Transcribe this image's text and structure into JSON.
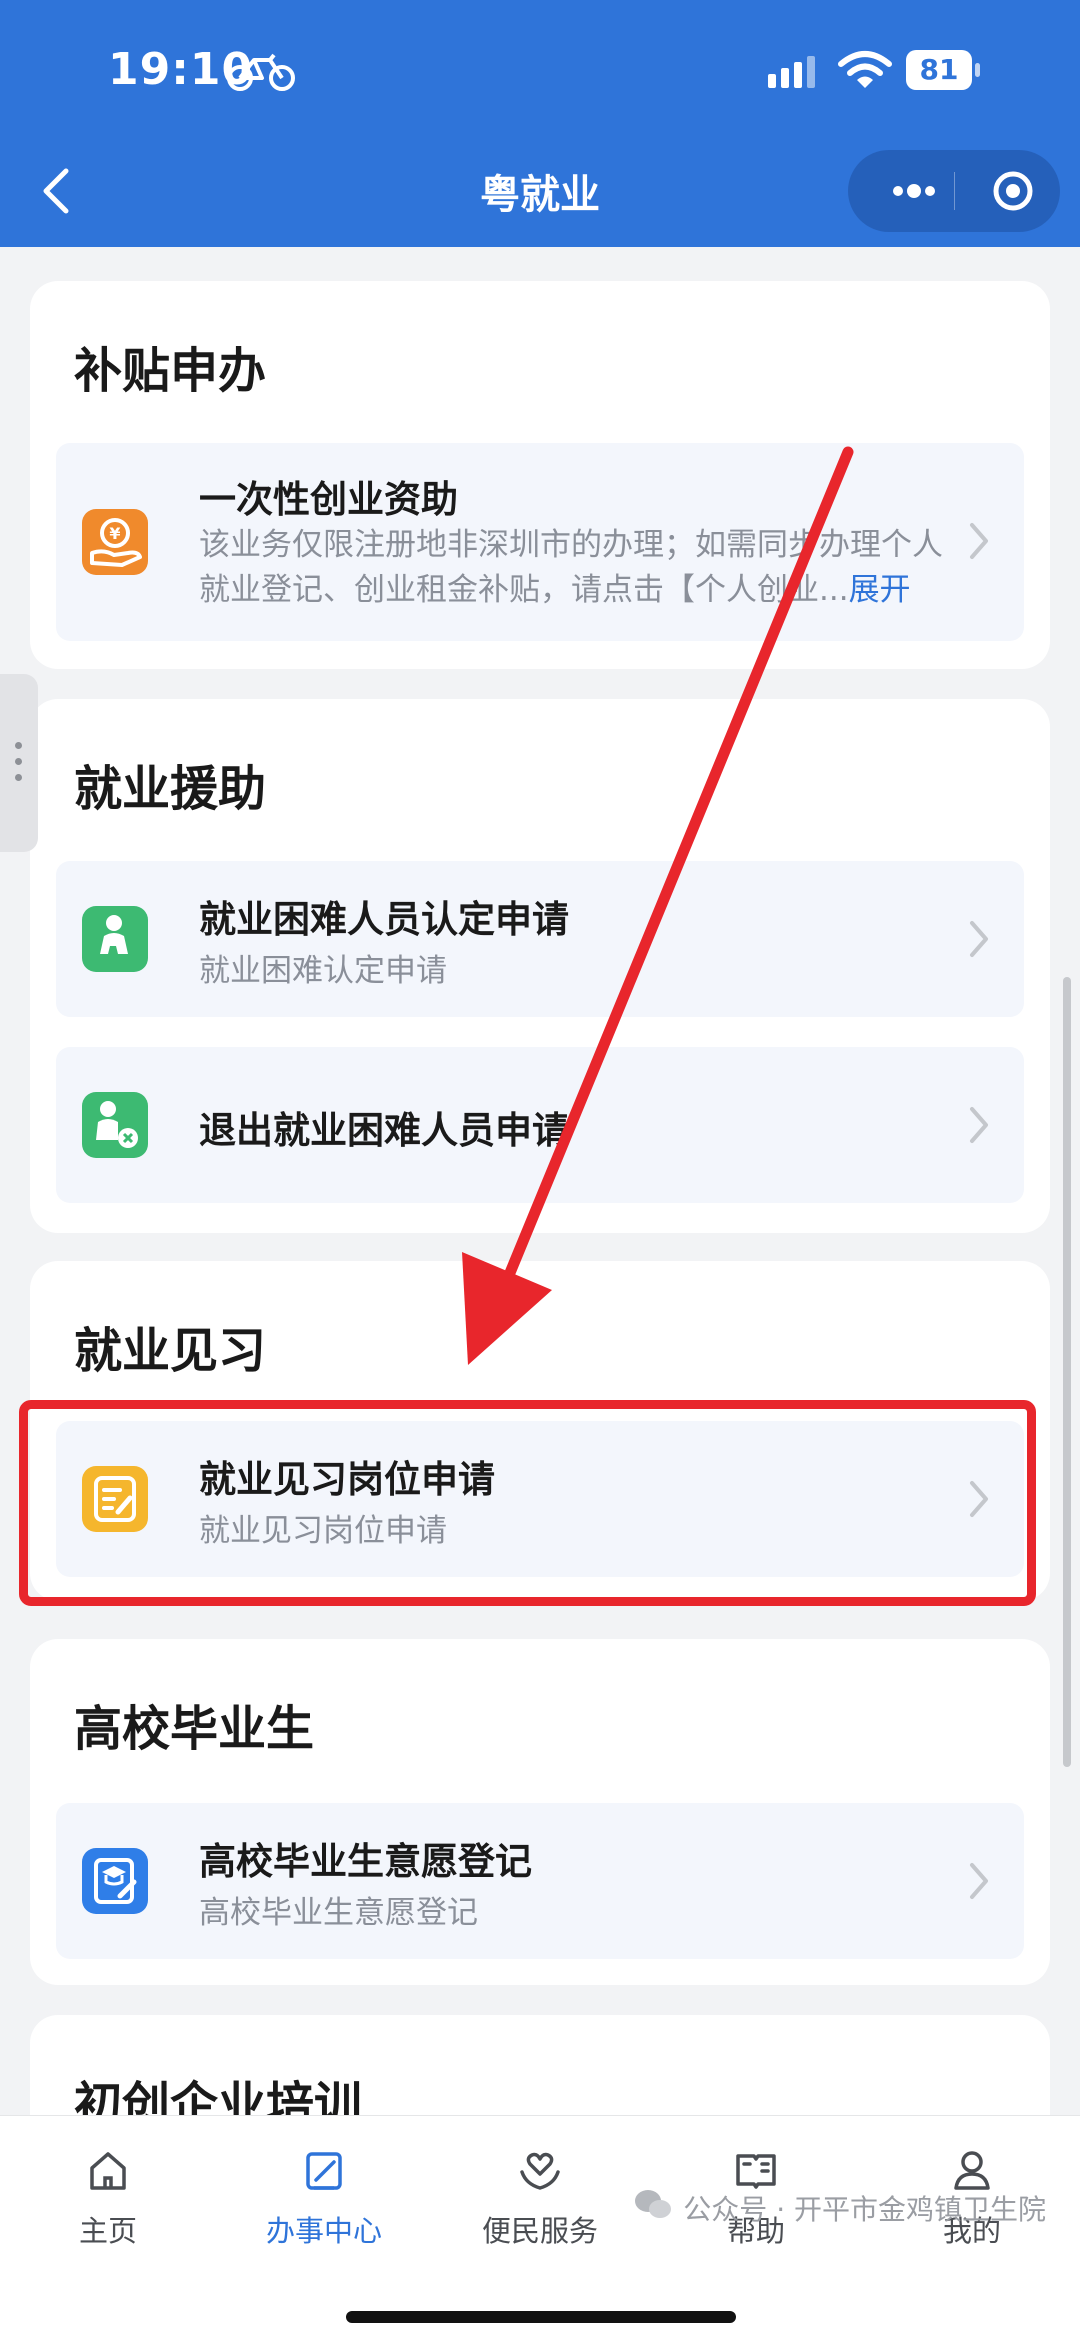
{
  "status_bar": {
    "time": "19:10",
    "battery": "81"
  },
  "nav": {
    "title": "粤就业"
  },
  "sections": [
    {
      "title": "补贴申办",
      "items": [
        {
          "title": "一次性创业资助",
          "description": "该业务仅限注册地非深圳市的办理；如需同步办理个人就业登记、创业租金补贴，请点击【个人创业...",
          "expand_label": "展开",
          "icon": "hand-coin-icon",
          "icon_color": "#f08a2c"
        }
      ]
    },
    {
      "title": "就业援助",
      "items": [
        {
          "title": "就业困难人员认定申请",
          "subtitle": "就业困难认定申请",
          "icon": "person-sitting-icon",
          "icon_color": "#3dba72"
        },
        {
          "title": "退出就业困难人员申请",
          "icon": "person-remove-icon",
          "icon_color": "#3dba72"
        }
      ]
    },
    {
      "title": "就业见习",
      "items": [
        {
          "title": "就业见习岗位申请",
          "subtitle": "就业见习岗位申请",
          "icon": "form-edit-icon",
          "icon_color": "#f5b62d"
        }
      ]
    },
    {
      "title": "高校毕业生",
      "items": [
        {
          "title": "高校毕业生意愿登记",
          "subtitle": "高校毕业生意愿登记",
          "icon": "graduate-form-icon",
          "icon_color": "#2f7ee8"
        }
      ]
    },
    {
      "title": "初创企业培训"
    }
  ],
  "tabbar": {
    "items": [
      {
        "label": "主页",
        "icon": "home-icon"
      },
      {
        "label": "办事中心",
        "icon": "edit-doc-icon",
        "active": true
      },
      {
        "label": "便民服务",
        "icon": "heart-hands-icon"
      },
      {
        "label": "帮助",
        "icon": "book-icon"
      },
      {
        "label": "我的",
        "icon": "user-icon"
      }
    ]
  },
  "watermark": {
    "text": "公众号 · 开平市金鸡镇卫生院"
  },
  "colors": {
    "primary": "#2f74d9",
    "highlight": "#e8262c"
  }
}
